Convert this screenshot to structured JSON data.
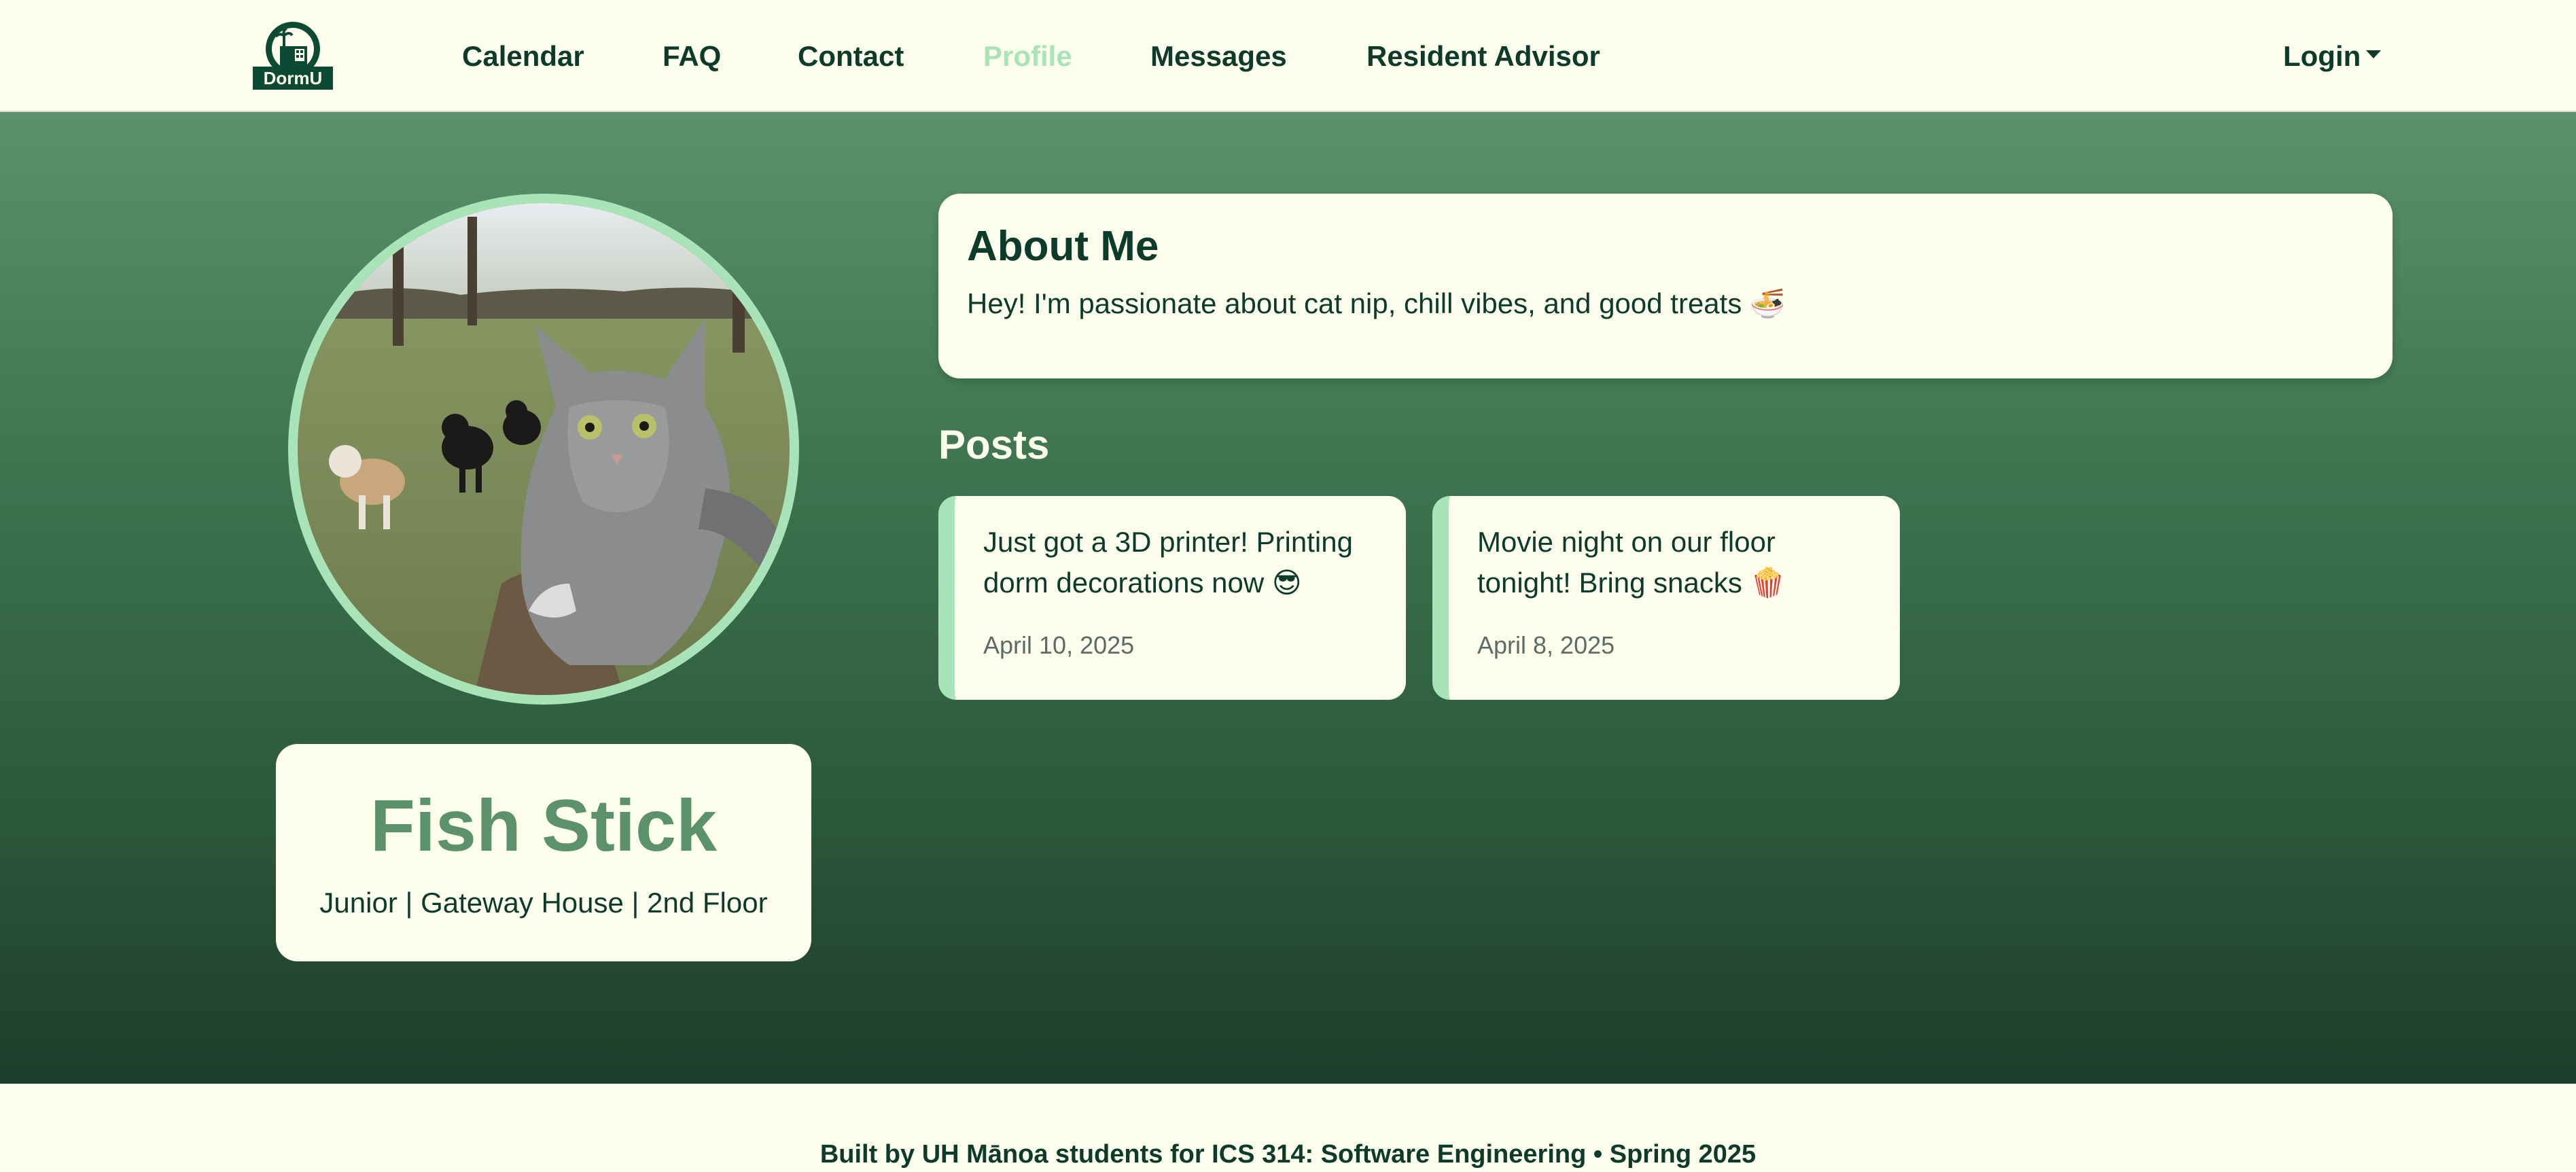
{
  "brand": {
    "logo_text": "DormU"
  },
  "nav": {
    "items": [
      {
        "label": "Calendar"
      },
      {
        "label": "FAQ"
      },
      {
        "label": "Contact"
      },
      {
        "label": "Profile"
      },
      {
        "label": "Messages"
      },
      {
        "label": "Resident Advisor"
      }
    ],
    "active": "Profile",
    "login_label": "Login"
  },
  "profile": {
    "name": "Fish Stick",
    "meta": "Junior | Gateway House | 2nd Floor",
    "avatar_icon": "cat-selfie-photo"
  },
  "about": {
    "title": "About Me",
    "text": "Hey! I'm passionate about cat nip, chill vibes, and good treats 🍜"
  },
  "posts": {
    "title": "Posts",
    "items": [
      {
        "text": "Just got a 3D printer! Printing dorm decorations now 😎",
        "date": "April 10, 2025"
      },
      {
        "text": "Movie night on our floor tonight! Bring snacks 🍿",
        "date": "April 8, 2025"
      }
    ]
  },
  "footer": {
    "text": "Built by UH Mānoa students for ICS 314: Software Engineering • Spring 2025"
  },
  "colors": {
    "primary_dark": "#0d3b2a",
    "accent_mint": "#a8e4b8",
    "green": "#5b9269",
    "cream": "#fdfdee"
  }
}
